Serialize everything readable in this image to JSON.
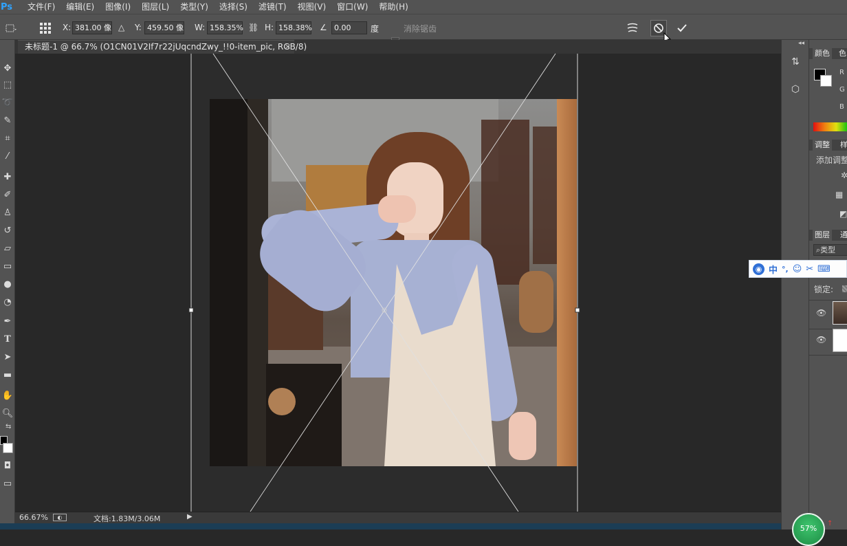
{
  "app": {
    "logo": "Ps",
    "menu": [
      "文件(F)",
      "编辑(E)",
      "图像(I)",
      "图层(L)",
      "类型(Y)",
      "选择(S)",
      "滤镜(T)",
      "视图(V)",
      "窗口(W)",
      "帮助(H)"
    ]
  },
  "options": {
    "x_label": "X:",
    "x_value": "381.00 像",
    "y_label": "Y:",
    "y_value": "459.50 像",
    "w_label": "W:",
    "w_value": "158.35%",
    "h_label": "H:",
    "h_value": "158.38%",
    "angle_value": "0.00",
    "angle_unit": "度",
    "antialias_label": "消除锯齿"
  },
  "document": {
    "tab_title": "未标题-1 @ 66.7% (O1CN01V2If7r22jUqcndZwy_!!0-item_pic, RGB/8)",
    "tab_close": "×"
  },
  "status": {
    "zoom": "66.67%",
    "doc_info": "文档:1.83M/3.06M"
  },
  "panels": {
    "color_tab": "颜色",
    "color_tab2": "色",
    "channel_r": "R",
    "channel_g": "G",
    "channel_b": "B",
    "adjust_tab": "调整",
    "adjust_tab2": "样",
    "adjust_add": "添加调整",
    "layers_tab": "图层",
    "layers_tab2": "通",
    "layers_filter": "类型",
    "lock_label": "锁定:"
  },
  "ime": {
    "lang": "中",
    "punct": "°,"
  },
  "overlay": {
    "progress_badge": "57%"
  }
}
